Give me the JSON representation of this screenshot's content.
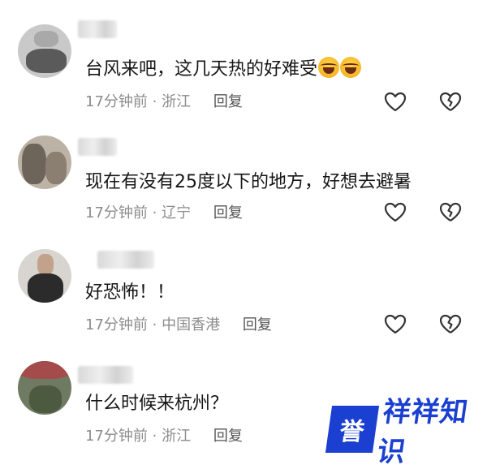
{
  "comments": [
    {
      "text": "台风来吧，这几天热的好难受",
      "emojis": [
        "laughing-crying-emoji",
        "laughing-crying-emoji"
      ],
      "time": "17分钟前",
      "location": "浙江",
      "reply_label": "回复"
    },
    {
      "text": "现在有没有25度以下的地方，好想去避暑",
      "time": "17分钟前",
      "location": "辽宁",
      "reply_label": "回复"
    },
    {
      "text": "好恐怖！！",
      "time": "17分钟前",
      "location": "中国香港",
      "reply_label": "回复"
    },
    {
      "text": "什么时候来杭州？",
      "time": "17分钟前",
      "location": "浙江",
      "reply_label": "回复"
    }
  ],
  "separator": "·",
  "watermark": {
    "box_text": "誉",
    "box_text2": "祥",
    "text": "祥知识"
  },
  "colors": {
    "text": "#161616",
    "meta": "#8c8c8c",
    "icon": "#333333",
    "brand": "#1a3fd1"
  }
}
